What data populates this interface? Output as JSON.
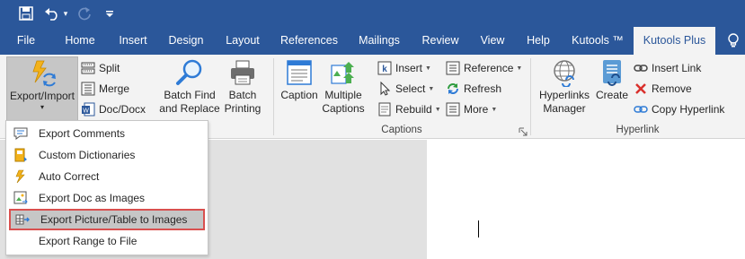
{
  "qat": {
    "save_icon": "save-icon",
    "undo_icon": "undo-icon",
    "undo_caret": "▾",
    "redo_icon": "redo-icon",
    "customize_icon": "customize-qat-icon"
  },
  "tabs": [
    {
      "label": "File"
    },
    {
      "label": "Home"
    },
    {
      "label": "Insert"
    },
    {
      "label": "Design"
    },
    {
      "label": "Layout"
    },
    {
      "label": "References"
    },
    {
      "label": "Mailings"
    },
    {
      "label": "Review"
    },
    {
      "label": "View"
    },
    {
      "label": "Help"
    },
    {
      "label": "Kutools ™"
    },
    {
      "label": "Kutools Plus"
    }
  ],
  "ribbon": {
    "export_import": {
      "label": "Export/Import",
      "caret": "▾"
    },
    "split": "Split",
    "merge": "Merge",
    "doc_docx": "Doc/Docx",
    "batch_find": {
      "line1": "Batch Find",
      "line2": "and Replace"
    },
    "batch_print": {
      "line1": "Batch",
      "line2": "Printing"
    },
    "caption": "Caption",
    "multiple_captions": {
      "line1": "Multiple",
      "line2": "Captions"
    },
    "insert": "Insert",
    "select": "Select",
    "rebuild": "Rebuild",
    "reference": "Reference",
    "refresh": "Refresh",
    "more": "More",
    "captions_group": "Captions",
    "hyperlinks_manager": {
      "line1": "Hyperlinks",
      "line2": "Manager"
    },
    "create": "Create",
    "insert_link": "Insert Link",
    "remove": "Remove",
    "copy_hyperlink": "Copy Hyperlink",
    "hyperlink_group": "Hyperlink"
  },
  "menu": {
    "items": [
      {
        "label": "Export Comments"
      },
      {
        "label": "Custom Dictionaries"
      },
      {
        "label": "Auto Correct"
      },
      {
        "label": "Export Doc as Images"
      },
      {
        "label": "Export Picture/Table to Images"
      },
      {
        "label": "Export Range to File"
      }
    ]
  },
  "colors": {
    "brand": "#2b579a",
    "ribbon_bg": "#f3f3f3",
    "highlight_border": "#d9504f"
  }
}
